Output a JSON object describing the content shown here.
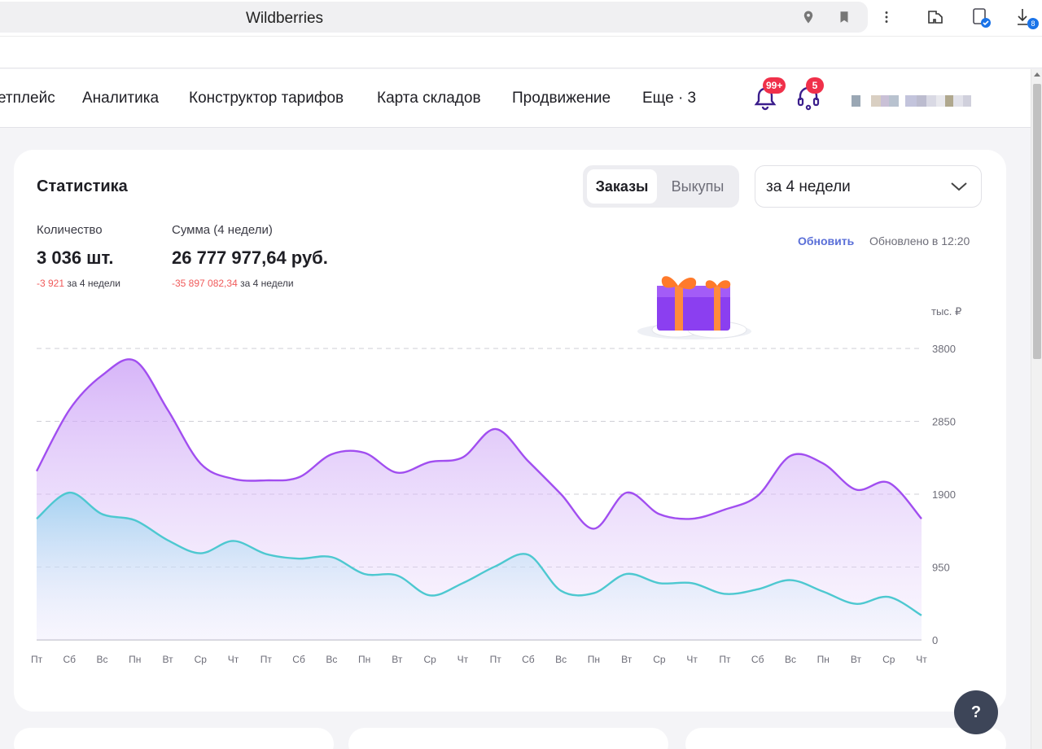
{
  "browser": {
    "tab_title": "Wildberries",
    "downloads_count": "8"
  },
  "nav": {
    "items": [
      "етплейс",
      "Аналитика",
      "Конструктор тарифов",
      "Карта складов",
      "Продвижение",
      "Еще · 3"
    ],
    "notifications_badge": "99+",
    "support_badge": "5"
  },
  "stats": {
    "title": "Статистика",
    "tabs": [
      "Заказы",
      "Выкупы"
    ],
    "active_tab": "Заказы",
    "period": "за 4 недели",
    "quantity": {
      "label": "Количество",
      "value": "3 036 шт.",
      "delta": "-3 921",
      "delta_suffix": "за 4 недели"
    },
    "sum": {
      "label": "Сумма (4 недели)",
      "value": "26 777 977,64 руб.",
      "delta": "-35 897 082,34",
      "delta_suffix": "за 4 недели"
    },
    "refresh_label": "Обновить",
    "updated_label": "Обновлено в 12:20"
  },
  "chart_data": {
    "type": "area",
    "ylabel": "тыс. ₽",
    "ylim": [
      0,
      3800
    ],
    "yticks": [
      0,
      950,
      1900,
      2850,
      3800
    ],
    "grid": true,
    "x": [
      "Пт",
      "Сб",
      "Вс",
      "Пн",
      "Вт",
      "Ср",
      "Чт",
      "Пт",
      "Сб",
      "Вс",
      "Пн",
      "Вт",
      "Ср",
      "Чт",
      "Пт",
      "Сб",
      "Вс",
      "Пн",
      "Вт",
      "Ср",
      "Чт",
      "Пт",
      "Сб",
      "Вс",
      "Пн",
      "Вт",
      "Ср",
      "Чт"
    ],
    "series": [
      {
        "color": "#a14ef0",
        "values": [
          2200,
          3000,
          3450,
          3640,
          3000,
          2300,
          2100,
          2080,
          2120,
          2420,
          2440,
          2180,
          2320,
          2380,
          2750,
          2330,
          1900,
          1450,
          1920,
          1640,
          1580,
          1700,
          1880,
          2400,
          2300,
          1960,
          2050,
          1580
        ]
      },
      {
        "color": "#4dc8d0",
        "values": [
          1580,
          1920,
          1640,
          1560,
          1300,
          1130,
          1290,
          1120,
          1060,
          1080,
          860,
          840,
          580,
          740,
          960,
          1110,
          640,
          610,
          860,
          740,
          740,
          600,
          660,
          780,
          630,
          470,
          560,
          320
        ]
      }
    ]
  },
  "help_label": "?"
}
